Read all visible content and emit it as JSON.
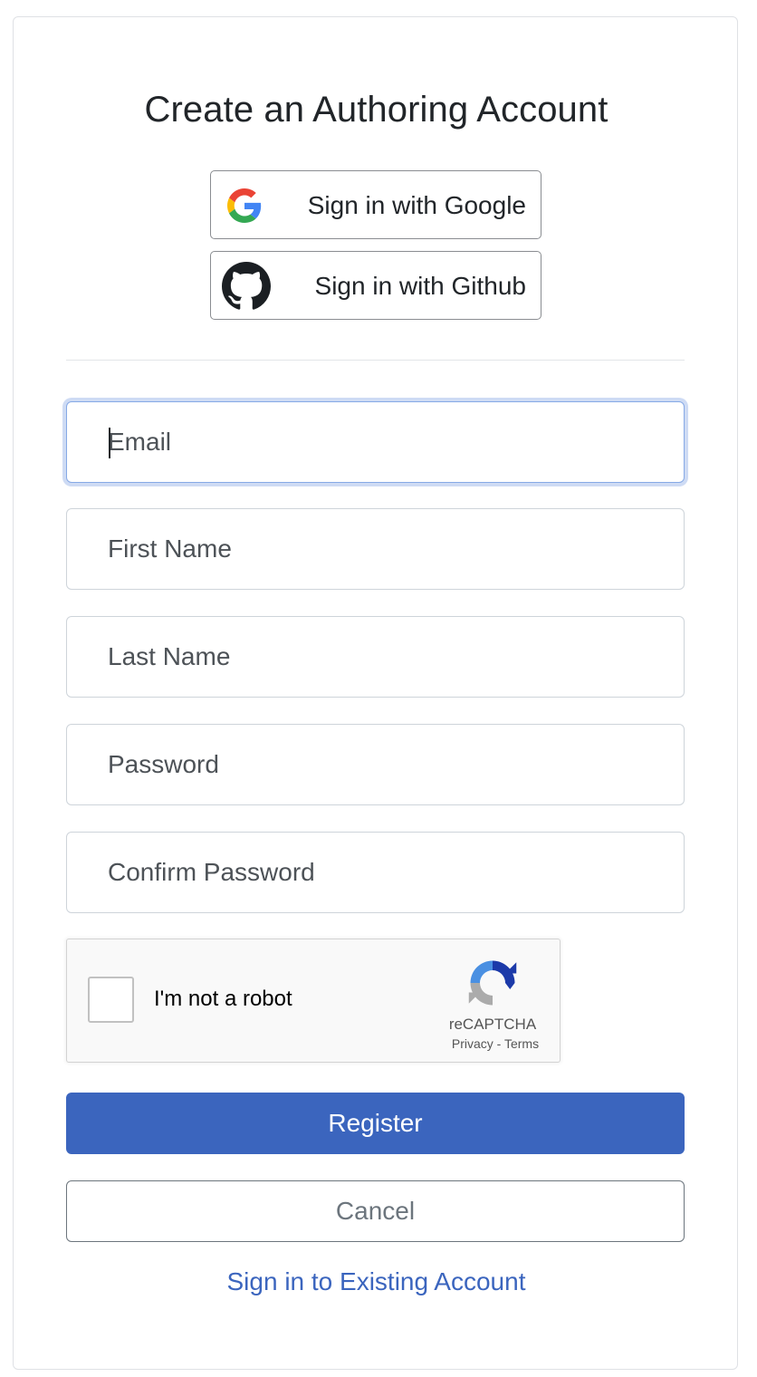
{
  "page": {
    "title": "Create an Authoring Account"
  },
  "oauth": {
    "google_label": "Sign in with Google",
    "github_label": "Sign in with Github"
  },
  "form": {
    "email_placeholder": "Email",
    "first_name_placeholder": "First Name",
    "last_name_placeholder": "Last Name",
    "password_placeholder": "Password",
    "confirm_password_placeholder": "Confirm Password"
  },
  "recaptcha": {
    "label": "I'm not a robot",
    "brand": "reCAPTCHA",
    "privacy": "Privacy",
    "separator": "-",
    "terms": "Terms"
  },
  "actions": {
    "register_label": "Register",
    "cancel_label": "Cancel",
    "signin_link": "Sign in to Existing Account"
  },
  "colors": {
    "primary": "#3b65be",
    "secondary": "#6c757d",
    "google_blue": "#4285F4",
    "google_red": "#EA4335",
    "google_yellow": "#FBBC05",
    "google_green": "#34A853"
  }
}
